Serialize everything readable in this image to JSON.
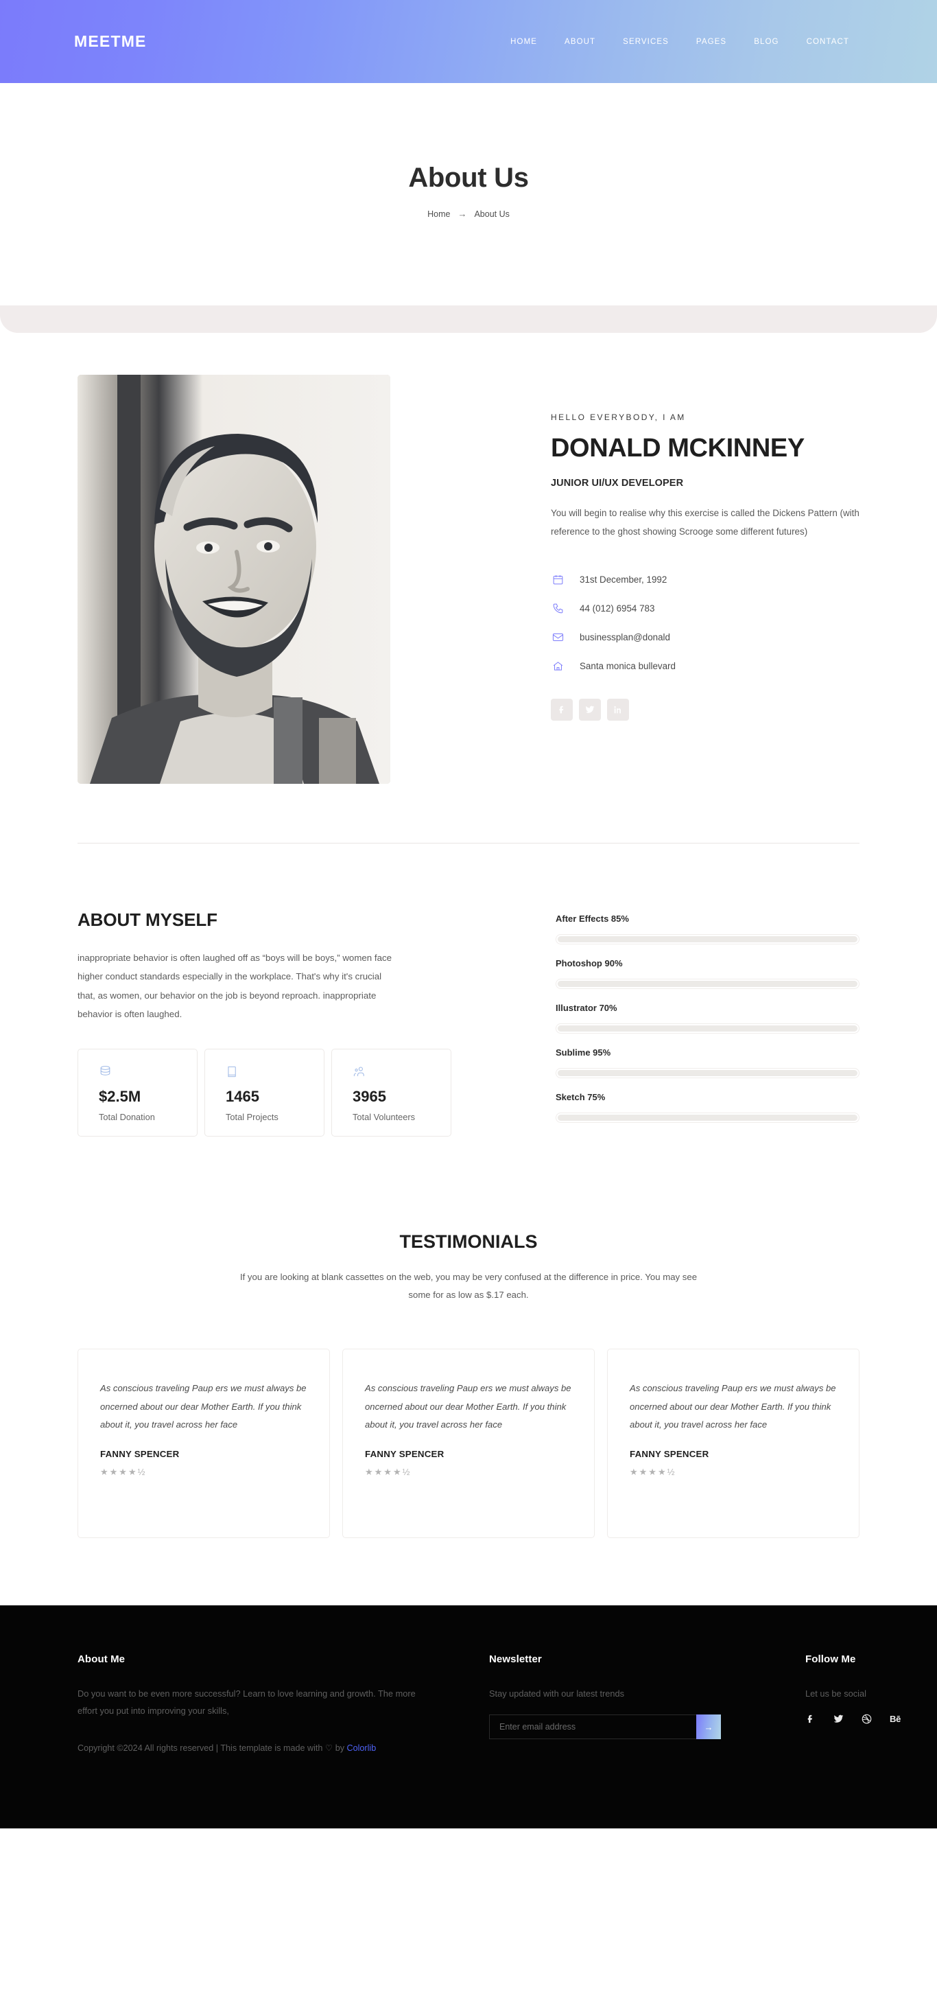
{
  "header": {
    "brand": "MEETME",
    "nav": [
      {
        "label": "HOME"
      },
      {
        "label": "ABOUT"
      },
      {
        "label": "SERVICES"
      },
      {
        "label": "PAGES"
      },
      {
        "label": "BLOG"
      },
      {
        "label": "CONTACT"
      }
    ],
    "gradient_from": "#7b7bfb",
    "gradient_to": "#b0d3e6"
  },
  "hero": {
    "title": "About Us",
    "breadcrumb_home": "Home",
    "breadcrumb_arrow": "→",
    "breadcrumb_current": "About Us"
  },
  "profile": {
    "eyebrow": "HELLO EVERYBODY, I AM",
    "name": "DONALD MCKINNEY",
    "role": "JUNIOR UI/UX DEVELOPER",
    "bio": "You will begin to realise why this exercise is called the Dickens Pattern (with reference to the ghost showing Scrooge some different futures)",
    "contacts": [
      {
        "icon": "calendar-icon",
        "text": "31st December, 1992"
      },
      {
        "icon": "phone-icon",
        "text": "44 (012) 6954 783"
      },
      {
        "icon": "mail-icon",
        "text": "businessplan@donald"
      },
      {
        "icon": "home-icon",
        "text": "Santa monica bullevard"
      }
    ],
    "socials": [
      {
        "icon": "facebook-icon",
        "label": "f"
      },
      {
        "icon": "twitter-icon",
        "label": "t"
      },
      {
        "icon": "linkedin-icon",
        "label": "in"
      }
    ],
    "accent": "#7b7bfb"
  },
  "about": {
    "title": "ABOUT MYSELF",
    "text": "inappropriate behavior is often laughed off as “boys will be boys,” women face higher conduct standards especially in the workplace. That's why it's crucial that, as women, our behavior on the job is beyond reproach. inappropriate behavior is often laughed.",
    "stats": [
      {
        "icon": "database-icon",
        "value": "$2.5M",
        "label": "Total Donation"
      },
      {
        "icon": "book-icon",
        "value": "1465",
        "label": "Total Projects"
      },
      {
        "icon": "people-icon",
        "value": "3965",
        "label": "Total Volunteers"
      }
    ]
  },
  "chart_data": {
    "type": "bar",
    "title": "",
    "xlabel": "",
    "ylabel": "",
    "categories": [
      "After Effects",
      "Photoshop",
      "Illustrator",
      "Sublime",
      "Sketch"
    ],
    "values": [
      85,
      90,
      70,
      95,
      75
    ],
    "labels": [
      "After Effects 85%",
      "Photoshop 90%",
      "Illustrator 70%",
      "Sublime 95%",
      "Sketch 75%"
    ],
    "ylim": [
      0,
      100
    ],
    "grid": false,
    "legend": "none",
    "note": "horizontal skill progress bars; fill tracks rendered unfilled (neutral track color)"
  },
  "testimonials": {
    "title": "TESTIMONIALS",
    "subtitle": "If you are looking at blank cassettes on the web, you may be very confused at the difference in price. You may see some for as low as $.17 each.",
    "cards": [
      {
        "quote": "As conscious traveling Paup ers we must always be oncerned about our dear Mother Earth. If you think about it, you travel across her face",
        "author": "FANNY SPENCER",
        "rating": "4.5",
        "stars": "★★★★½"
      },
      {
        "quote": "As conscious traveling Paup ers we must always be oncerned about our dear Mother Earth. If you think about it, you travel across her face",
        "author": "FANNY SPENCER",
        "rating": "4.5",
        "stars": "★★★★½"
      },
      {
        "quote": "As conscious traveling Paup ers we must always be oncerned about our dear Mother Earth. If you think about it, you travel across her face",
        "author": "FANNY SPENCER",
        "rating": "4.5",
        "stars": "★★★★½"
      }
    ]
  },
  "footer": {
    "about_title": "About Me",
    "about_text": "Do you want to be even more successful? Learn to love learning and growth. The more effort you put into improving your skills,",
    "copyright_prefix": "Copyright ©2024 All rights reserved | This template is made with ",
    "copyright_heart": "♡",
    "copyright_mid": " by ",
    "copyright_link": "Colorlib",
    "news_title": "Newsletter",
    "news_text": "Stay updated with our latest trends",
    "news_placeholder": "Enter email address",
    "news_value": "",
    "news_button": "→",
    "follow_title": "Follow Me",
    "follow_text": "Let us be social",
    "follow_icons": [
      {
        "icon": "facebook-icon",
        "label": "f"
      },
      {
        "icon": "twitter-icon",
        "label": "t"
      },
      {
        "icon": "dribbble-icon",
        "label": "d"
      },
      {
        "icon": "behance-icon",
        "label": "Bē"
      }
    ],
    "link_color": "#4f63f7"
  }
}
